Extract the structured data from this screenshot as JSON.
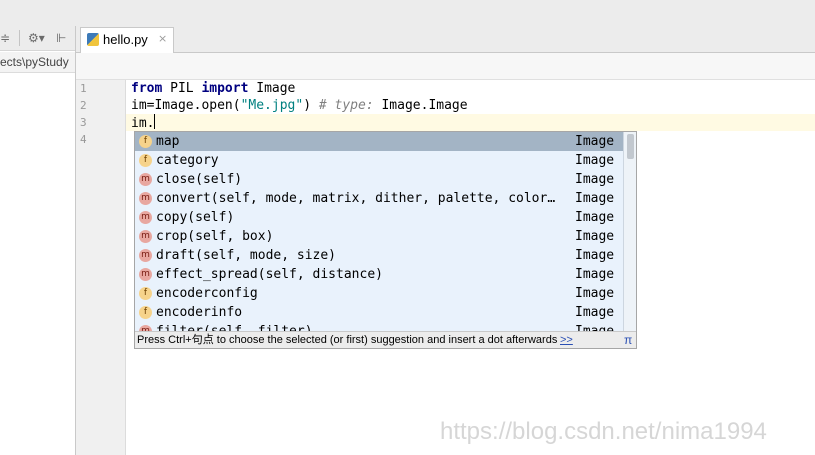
{
  "sidebar": {
    "project_path": "ects\\pyStudy",
    "toolbar_icons": [
      "collapse-icon",
      "settings-gear-icon",
      "pin-icon"
    ]
  },
  "tabs": [
    {
      "label": "hello.py",
      "close": "×",
      "icon": "python-file-icon"
    }
  ],
  "gutter": {
    "line_numbers": [
      "1",
      "2",
      "3",
      "4"
    ]
  },
  "code": {
    "line1": {
      "kw1": "from",
      "mod": " PIL ",
      "kw2": "import",
      "rest": " Image"
    },
    "line2": {
      "pre": "im=Image.open(",
      "str": "\"Me.jpg\"",
      "post": ") ",
      "comment": "# type: ",
      "type": "Image.Image"
    },
    "line3": {
      "text": "im."
    }
  },
  "completion": {
    "items": [
      {
        "kind": "f",
        "name": "map",
        "type": "Image"
      },
      {
        "kind": "f",
        "name": "category",
        "type": "Image"
      },
      {
        "kind": "m",
        "name": "close(self)",
        "type": "Image"
      },
      {
        "kind": "m",
        "name": "convert(self, mode, matrix, dither, palette, color…",
        "type": "Image"
      },
      {
        "kind": "m",
        "name": "copy(self)",
        "type": "Image"
      },
      {
        "kind": "m",
        "name": "crop(self, box)",
        "type": "Image"
      },
      {
        "kind": "m",
        "name": "draft(self, mode, size)",
        "type": "Image"
      },
      {
        "kind": "m",
        "name": "effect_spread(self, distance)",
        "type": "Image"
      },
      {
        "kind": "f",
        "name": "encoderconfig",
        "type": "Image"
      },
      {
        "kind": "f",
        "name": "encoderinfo",
        "type": "Image"
      },
      {
        "kind": "m",
        "name": "filter(self, filter)",
        "type": "Image"
      }
    ],
    "footer_hint": "Press Ctrl+句点 to choose the selected (or first) suggestion and insert a dot afterwards",
    "footer_link": ">>",
    "footer_pi": "π"
  },
  "watermark": "https://blog.csdn.net/nima1994",
  "colors": {
    "selection": "#a3b4c5",
    "popup_bg": "#e9f2fc",
    "keyword": "#000080",
    "string": "#008080",
    "comment": "#808080"
  }
}
